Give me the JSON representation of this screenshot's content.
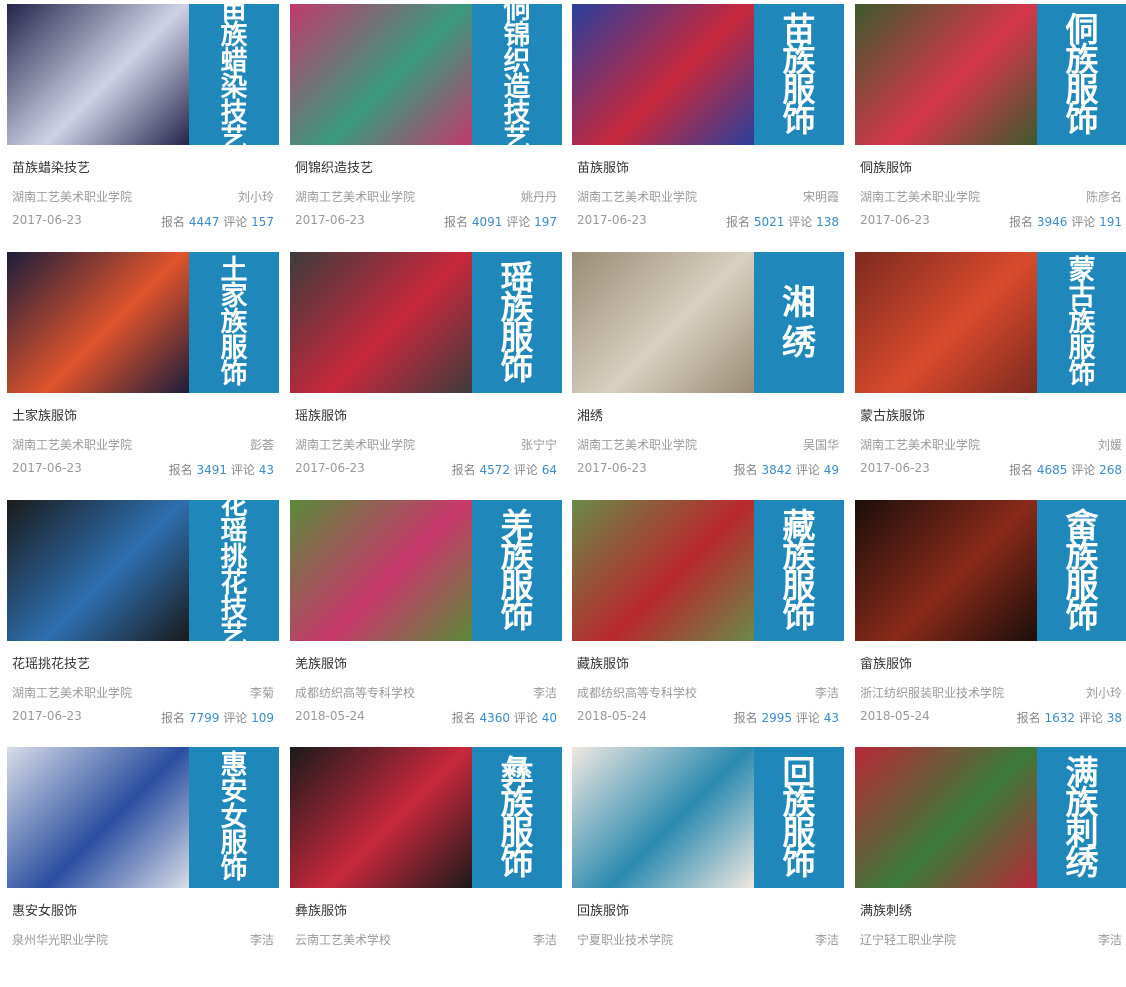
{
  "colors": {
    "panel_blue": "#1f87b9",
    "accent": "#3a8dc8",
    "muted": "#999999"
  },
  "courses": [
    {
      "title": "苗族蜡染技艺",
      "panel": "苗族蜡染技艺",
      "school": "湖南工艺美术职业学院",
      "teacher": "刘小玲",
      "date": "2017-06-23",
      "signup_label": "报名",
      "signup": "4447",
      "comment_label": "评论",
      "comments": "157",
      "photo_colors": [
        "#22254a",
        "#cfd2e6"
      ]
    },
    {
      "title": "侗锦织造技艺",
      "panel": "侗锦织造技艺",
      "school": "湖南工艺美术职业学院",
      "teacher": "姚丹丹",
      "date": "2017-06-23",
      "signup_label": "报名",
      "signup": "4091",
      "comment_label": "评论",
      "comments": "197",
      "photo_colors": [
        "#c13a6c",
        "#3a9a7e"
      ]
    },
    {
      "title": "苗族服饰",
      "panel": "苗族服饰",
      "school": "湖南工艺美术职业学院",
      "teacher": "宋明霞",
      "date": "2017-06-23",
      "signup_label": "报名",
      "signup": "5021",
      "comment_label": "评论",
      "comments": "138",
      "photo_colors": [
        "#2a3f9c",
        "#c8283c"
      ]
    },
    {
      "title": "侗族服饰",
      "panel": "侗族服饰",
      "school": "湖南工艺美术职业学院",
      "teacher": "陈彦名",
      "date": "2017-06-23",
      "signup_label": "报名",
      "signup": "3946",
      "comment_label": "评论",
      "comments": "191",
      "photo_colors": [
        "#3c5a2c",
        "#d6364c"
      ]
    },
    {
      "title": "土家族服饰",
      "panel": "土家族服饰",
      "school": "湖南工艺美术职业学院",
      "teacher": "彭荟",
      "date": "2017-06-23",
      "signup_label": "报名",
      "signup": "3491",
      "comment_label": "评论",
      "comments": "43",
      "photo_colors": [
        "#1b1d3b",
        "#e0542c"
      ]
    },
    {
      "title": "瑶族服饰",
      "panel": "瑶族服饰",
      "school": "湖南工艺美术职业学院",
      "teacher": "张宁宁",
      "date": "2017-06-23",
      "signup_label": "报名",
      "signup": "4572",
      "comment_label": "评论",
      "comments": "64",
      "photo_colors": [
        "#3c3c3c",
        "#c8283c"
      ]
    },
    {
      "title": "湘绣",
      "panel": "湘绣",
      "school": "湖南工艺美术职业学院",
      "teacher": "吴国华",
      "date": "2017-06-23",
      "signup_label": "报名",
      "signup": "3842",
      "comment_label": "评论",
      "comments": "49",
      "photo_colors": [
        "#9a8c74",
        "#d8d0c0"
      ]
    },
    {
      "title": "蒙古族服饰",
      "panel": "蒙古族服饰",
      "school": "湖南工艺美术职业学院",
      "teacher": "刘媛",
      "date": "2017-06-23",
      "signup_label": "报名",
      "signup": "4685",
      "comment_label": "评论",
      "comments": "268",
      "photo_colors": [
        "#7c2a20",
        "#d94a2c"
      ]
    },
    {
      "title": "花瑶挑花技艺",
      "panel": "花瑶挑花技艺",
      "school": "湖南工艺美术职业学院",
      "teacher": "李菊",
      "date": "2017-06-23",
      "signup_label": "报名",
      "signup": "7799",
      "comment_label": "评论",
      "comments": "109",
      "photo_colors": [
        "#1a1a1a",
        "#2e6fb0"
      ]
    },
    {
      "title": "羌族服饰",
      "panel": "羌族服饰",
      "school": "成都纺织高等专科学校",
      "teacher": "李洁",
      "date": "2018-05-24",
      "signup_label": "报名",
      "signup": "4360",
      "comment_label": "评论",
      "comments": "40",
      "photo_colors": [
        "#5a8a3a",
        "#c8386c"
      ]
    },
    {
      "title": "藏族服饰",
      "panel": "藏族服饰",
      "school": "成都纺织高等专科学校",
      "teacher": "李洁",
      "date": "2018-05-24",
      "signup_label": "报名",
      "signup": "2995",
      "comment_label": "评论",
      "comments": "43",
      "photo_colors": [
        "#6a8a4a",
        "#b8282c"
      ]
    },
    {
      "title": "畲族服饰",
      "panel": "畲族服饰",
      "school": "浙江纺织服装职业技术学院",
      "teacher": "刘小玲",
      "date": "2018-05-24",
      "signup_label": "报名",
      "signup": "1632",
      "comment_label": "评论",
      "comments": "38",
      "photo_colors": [
        "#1a0e0a",
        "#8a2a1a"
      ]
    },
    {
      "title": "惠安女服饰",
      "panel": "惠安女服饰",
      "school": "泉州华光职业学院",
      "teacher": "李洁",
      "date": "",
      "signup_label": "",
      "signup": "",
      "comment_label": "",
      "comments": "",
      "photo_colors": [
        "#d8dde8",
        "#2a4ea0"
      ]
    },
    {
      "title": "彝族服饰",
      "panel": "彝族服饰",
      "school": "云南工艺美术学校",
      "teacher": "李洁",
      "date": "",
      "signup_label": "",
      "signup": "",
      "comment_label": "",
      "comments": "",
      "photo_colors": [
        "#1a1a1a",
        "#c8283c"
      ]
    },
    {
      "title": "回族服饰",
      "panel": "回族服饰",
      "school": "宁夏职业技术学院",
      "teacher": "李洁",
      "date": "",
      "signup_label": "",
      "signup": "",
      "comment_label": "",
      "comments": "",
      "photo_colors": [
        "#f0e8e0",
        "#2a8ab0"
      ]
    },
    {
      "title": "满族刺绣",
      "panel": "满族刺绣",
      "school": "辽宁轻工职业学院",
      "teacher": "李洁",
      "date": "",
      "signup_label": "",
      "signup": "",
      "comment_label": "",
      "comments": "",
      "photo_colors": [
        "#b82838",
        "#3a7a3a"
      ]
    }
  ]
}
